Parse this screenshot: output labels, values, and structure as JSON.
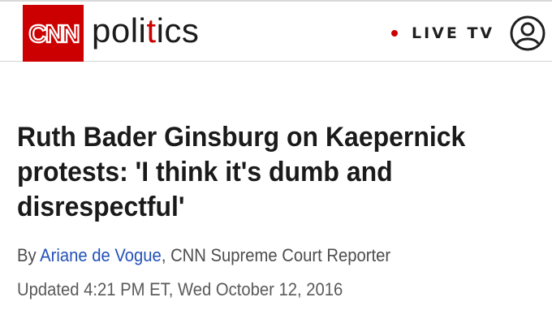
{
  "header": {
    "logo_text": "CNN",
    "section_prefix": "poli",
    "section_accent": "t",
    "section_suffix": "ics",
    "live_tv_label": "LIVE TV",
    "icons": [
      "cnn-logo",
      "live-dot",
      "account-icon"
    ],
    "colors": {
      "brand_red": "#cc0000",
      "link_blue": "#2451b8"
    }
  },
  "article": {
    "headline": "Ruth Bader Ginsburg on Kaepernick protests: 'I think it's dumb and disrespectful'",
    "byline_prefix": "By ",
    "author_name": "Ariane de Vogue",
    "author_role": ", CNN Supreme Court Reporter",
    "updated": "Updated 4:21 PM ET, Wed October 12, 2016"
  }
}
